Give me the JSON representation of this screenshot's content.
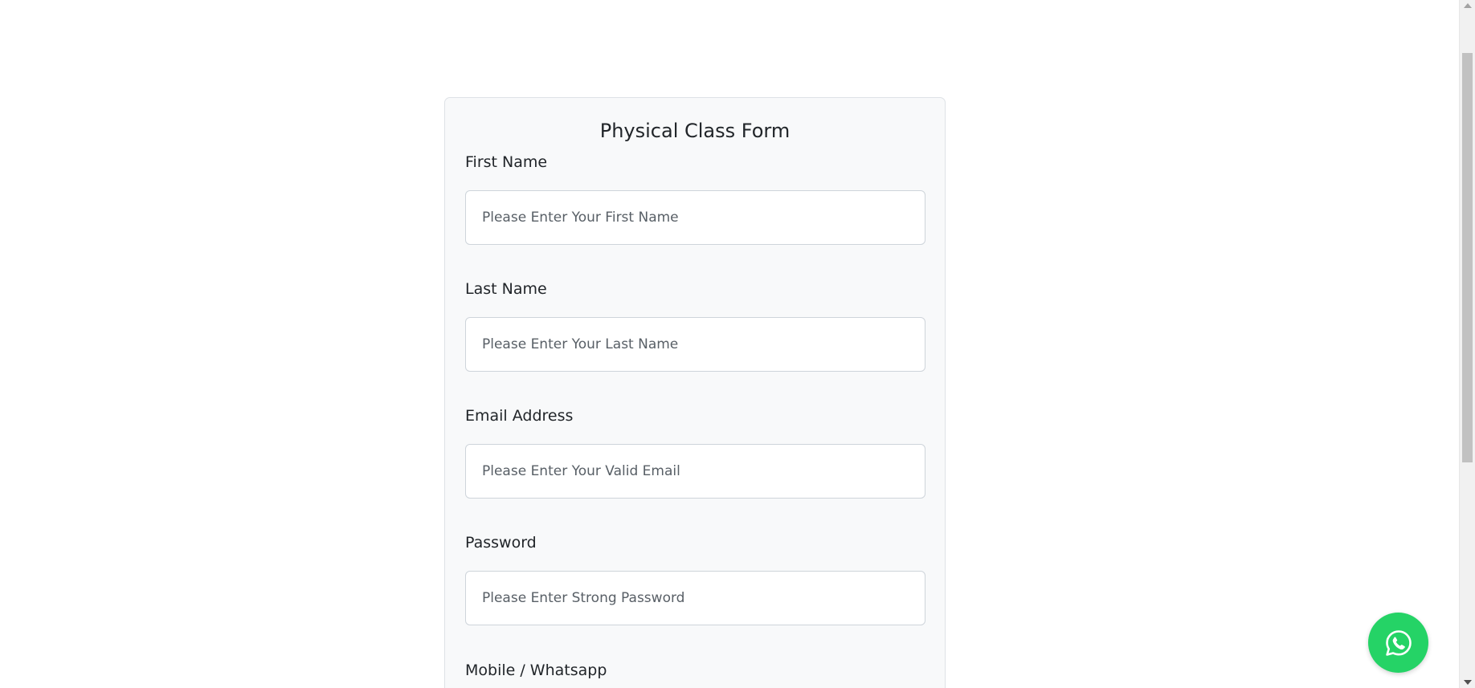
{
  "form": {
    "title": "Physical Class Form",
    "fields": [
      {
        "label": "First Name",
        "placeholder": "Please Enter Your First Name",
        "value": ""
      },
      {
        "label": "Last Name",
        "placeholder": "Please Enter Your Last Name",
        "value": ""
      },
      {
        "label": "Email Address",
        "placeholder": "Please Enter Your Valid Email",
        "value": ""
      },
      {
        "label": "Password",
        "placeholder": "Please Enter Strong Password",
        "value": ""
      },
      {
        "label": "Mobile / Whatsapp",
        "placeholder": "",
        "value": ""
      }
    ]
  },
  "floating_button": {
    "icon": "whatsapp-icon",
    "color": "#25d366"
  },
  "colors": {
    "card_background": "#f8f9fa",
    "page_background": "#ffffff",
    "text": "#212529"
  }
}
